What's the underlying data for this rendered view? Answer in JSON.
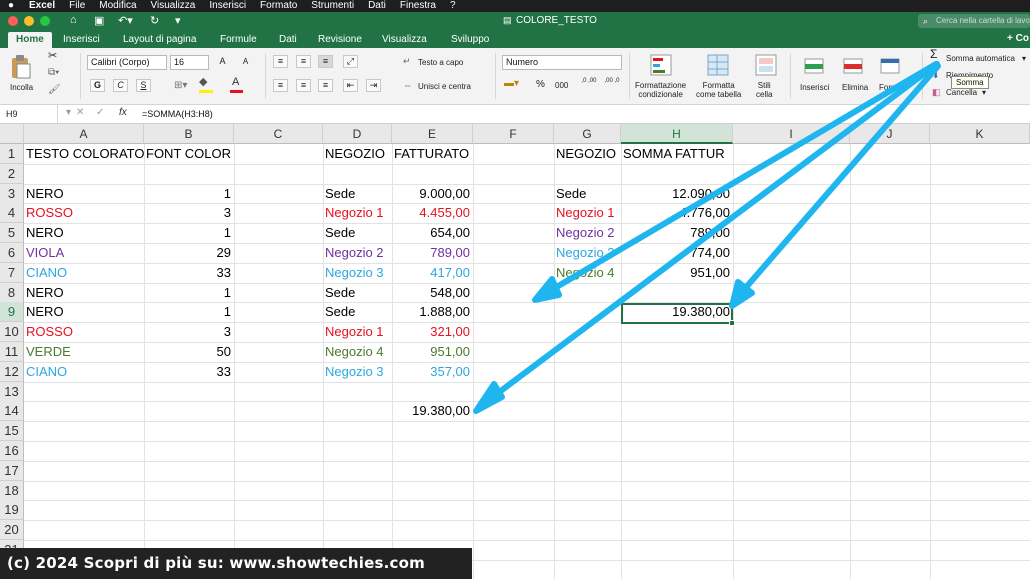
{
  "menubar": {
    "app": "Excel",
    "items": [
      "File",
      "Modifica",
      "Visualizza",
      "Inserisci",
      "Formato",
      "Strumenti",
      "Dati",
      "Finestra",
      "?"
    ]
  },
  "window": {
    "title": "COLORE_TESTO",
    "search_placeholder": "Cerca nella cartella di lavoro"
  },
  "ribbon_tabs": [
    "Home",
    "Inserisci",
    "Layout di pagina",
    "Formule",
    "Dati",
    "Revisione",
    "Visualizza",
    "Sviluppo"
  ],
  "share_label": "+ Co",
  "ribbon": {
    "paste": "Incolla",
    "font_name": "Calibri (Corpo)",
    "font_size": "16",
    "bold": "G",
    "italic": "C",
    "underline": "S",
    "font_grow": "A",
    "font_shrink": "A",
    "wrap_text": "Testo a capo",
    "merge_center": "Unisci e centra",
    "number_format": "Numero",
    "percent": "%",
    "thousands": "000",
    "dec_inc": ",0 ,00",
    "dec_dec": ",00 ,0",
    "cond_format": "Formattazione\ncondizionale",
    "format_table": "Formatta\ncome tabella",
    "cell_styles": "Stili\ncella",
    "insert": "Inserisci",
    "delete": "Elimina",
    "format": "Form",
    "autosum": "Somma automatica",
    "fill": "Riempimento",
    "clear": "Cancella",
    "tooltip": "Somma"
  },
  "formula_bar": {
    "name_box": "H9",
    "fx": "fx",
    "formula": "=SOMMA(H3:H8)"
  },
  "columns": [
    "A",
    "B",
    "C",
    "D",
    "E",
    "F",
    "G",
    "H",
    "I",
    "J",
    "K"
  ],
  "selected_column": "H",
  "rows": [
    "1",
    "2",
    "3",
    "4",
    "5",
    "6",
    "7",
    "8",
    "9",
    "10",
    "11",
    "12",
    "13",
    "14",
    "15",
    "16",
    "17",
    "18",
    "19",
    "20",
    "21"
  ],
  "selected_row": "9",
  "colors": {
    "black": "#000000",
    "red": "#e8101d",
    "purple": "#7030a0",
    "cyan": "#2da6e0",
    "green": "#4a7a2c",
    "excel_green": "#217346",
    "arrow": "#1fb5ef"
  },
  "cells": {
    "A1": "TESTO COLORATO",
    "B1": "FONT COLOR",
    "D1": "NEGOZIO",
    "E1": "FATTURATO",
    "G1": "NEGOZIO",
    "H1": "SOMMA FATTUR",
    "A3": "NERO",
    "B3": "1",
    "D3": "Sede",
    "E3": "9.000,00",
    "G3": "Sede",
    "H3": "12.090,00",
    "A4": "ROSSO",
    "B4": "3",
    "D4": "Negozio 1",
    "E4": "4.455,00",
    "G4": "Negozio 1",
    "H4": "4.776,00",
    "A5": "NERO",
    "B5": "1",
    "D5": "Sede",
    "E5": "654,00",
    "G5": "Negozio 2",
    "H5": "789,00",
    "A6": "VIOLA",
    "B6": "29",
    "D6": "Negozio 2",
    "E6": "789,00",
    "G6": "Negozio 3",
    "H6": "774,00",
    "A7": "CIANO",
    "B7": "33",
    "D7": "Negozio 3",
    "E7": "417,00",
    "G7": "Negozio 4",
    "H7": "951,00",
    "A8": "NERO",
    "B8": "1",
    "D8": "Sede",
    "E8": "548,00",
    "A9": "NERO",
    "B9": "1",
    "D9": "Sede",
    "E9": "1.888,00",
    "H9": "19.380,00",
    "A10": "ROSSO",
    "B10": "3",
    "D10": "Negozio 1",
    "E10": "321,00",
    "A11": "VERDE",
    "B11": "50",
    "D11": "Negozio 4",
    "E11": "951,00",
    "A12": "CIANO",
    "B12": "33",
    "D12": "Negozio 3",
    "E12": "357,00",
    "E14": "19.380,00"
  },
  "watermark": "(c) 2024 Scopri di più su: www.showtechies.com"
}
